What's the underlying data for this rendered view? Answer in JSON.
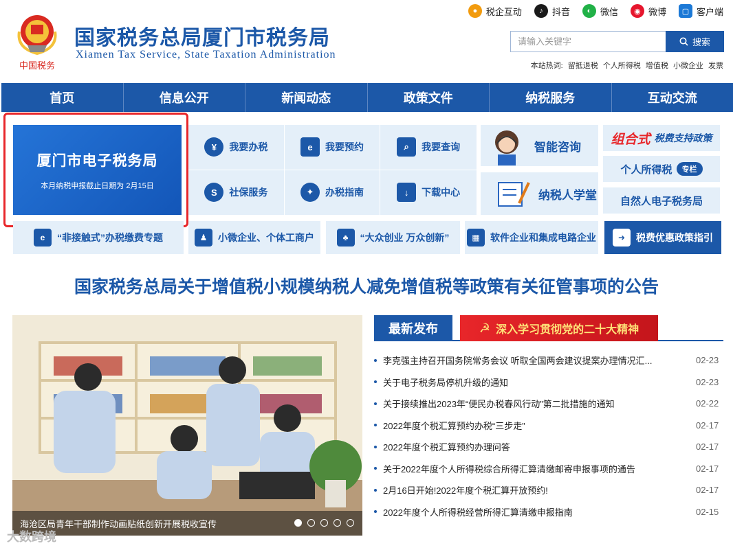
{
  "header": {
    "title": "国家税务总局厦门市税务局",
    "subtitle": "Xiamen Tax Service, State Taxation Administration",
    "emblem_text": "中国税务",
    "social": [
      {
        "label": "税企互动",
        "icon": "chat-bubble-icon",
        "color": "#f29b0e"
      },
      {
        "label": "抖音",
        "icon": "tiktok-icon",
        "color": "#1a1a1a"
      },
      {
        "label": "微信",
        "icon": "wechat-icon",
        "color": "#21b147"
      },
      {
        "label": "微博",
        "icon": "weibo-icon",
        "color": "#e6162d"
      },
      {
        "label": "客户端",
        "icon": "mobile-app-icon",
        "color": "#1c79d6"
      }
    ],
    "search": {
      "placeholder": "请输入关键字",
      "button": "搜索"
    },
    "hotwords": {
      "label": "本站热词:",
      "items": [
        "留抵退税",
        "个人所得税",
        "增值税",
        "小微企业",
        "发票"
      ]
    }
  },
  "nav": [
    "首页",
    "信息公开",
    "新闻动态",
    "政策文件",
    "纳税服务",
    "互动交流"
  ],
  "etax": {
    "title": "厦门市电子税务局",
    "deadline": "本月纳税申报截止日期为 2月15日"
  },
  "services": [
    {
      "label": "我要办税",
      "icon": "hand-coin-icon"
    },
    {
      "label": "我要预约",
      "icon": "monitor-e-icon"
    },
    {
      "label": "我要查询",
      "icon": "document-search-icon"
    },
    {
      "label": "社保服务",
      "icon": "social-security-icon"
    },
    {
      "label": "办税指南",
      "icon": "compass-icon"
    },
    {
      "label": "下载中心",
      "icon": "download-icon"
    }
  ],
  "feature_cards": [
    {
      "label": "智能咨询",
      "icon": "customer-service-avatar-icon"
    },
    {
      "label": "纳税人学堂",
      "icon": "book-pen-icon"
    }
  ],
  "side_links": [
    {
      "label": "税费支持政策",
      "prefix": "组合式"
    },
    {
      "label": "个人所得税",
      "tag": "专栏"
    },
    {
      "label": "自然人电子税务局"
    }
  ],
  "topic_row": [
    {
      "label": "“非接触式”办税缴费专题",
      "icon": "monitor-e-icon"
    },
    {
      "label": "小微企业、个体工商户",
      "icon": "person-upload-icon"
    },
    {
      "label": "“大众创业 万众创新”",
      "icon": "group-people-icon"
    },
    {
      "label": "软件企业和集成电路企业",
      "icon": "building-icon"
    },
    {
      "label": "税费优惠政策指引",
      "icon": "arrow-right-icon"
    }
  ],
  "headline": "国家税务总局关于增值税小规模纳税人减免增值税等政策有关征管事项的公告",
  "carousel": {
    "caption": "海沧区局青年干部制作动画贴纸创新开展税收宣传",
    "slides": 5,
    "active": 0
  },
  "latest": {
    "tab": "最新发布",
    "banner": "深入学习贯彻党的二十大精神",
    "items": [
      {
        "title": "李克强主持召开国务院常务会议 听取全国两会建议提案办理情况汇...",
        "date": "02-23"
      },
      {
        "title": "关于电子税务局停机升级的通知",
        "date": "02-23"
      },
      {
        "title": "关于接续推出2023年“便民办税春风行动”第二批措施的通知",
        "date": "02-22"
      },
      {
        "title": "2022年度个税汇算预约办税“三步走”",
        "date": "02-17"
      },
      {
        "title": "2022年度个税汇算预约办理问答",
        "date": "02-17"
      },
      {
        "title": "关于2022年度个人所得税综合所得汇算清缴邮寄申报事项的通告",
        "date": "02-17"
      },
      {
        "title": "2月16日开始!2022年度个税汇算开放预约!",
        "date": "02-17"
      },
      {
        "title": "2022年度个人所得税经营所得汇算清缴申报指南",
        "date": "02-15"
      }
    ]
  },
  "watermark": "大数跨境"
}
